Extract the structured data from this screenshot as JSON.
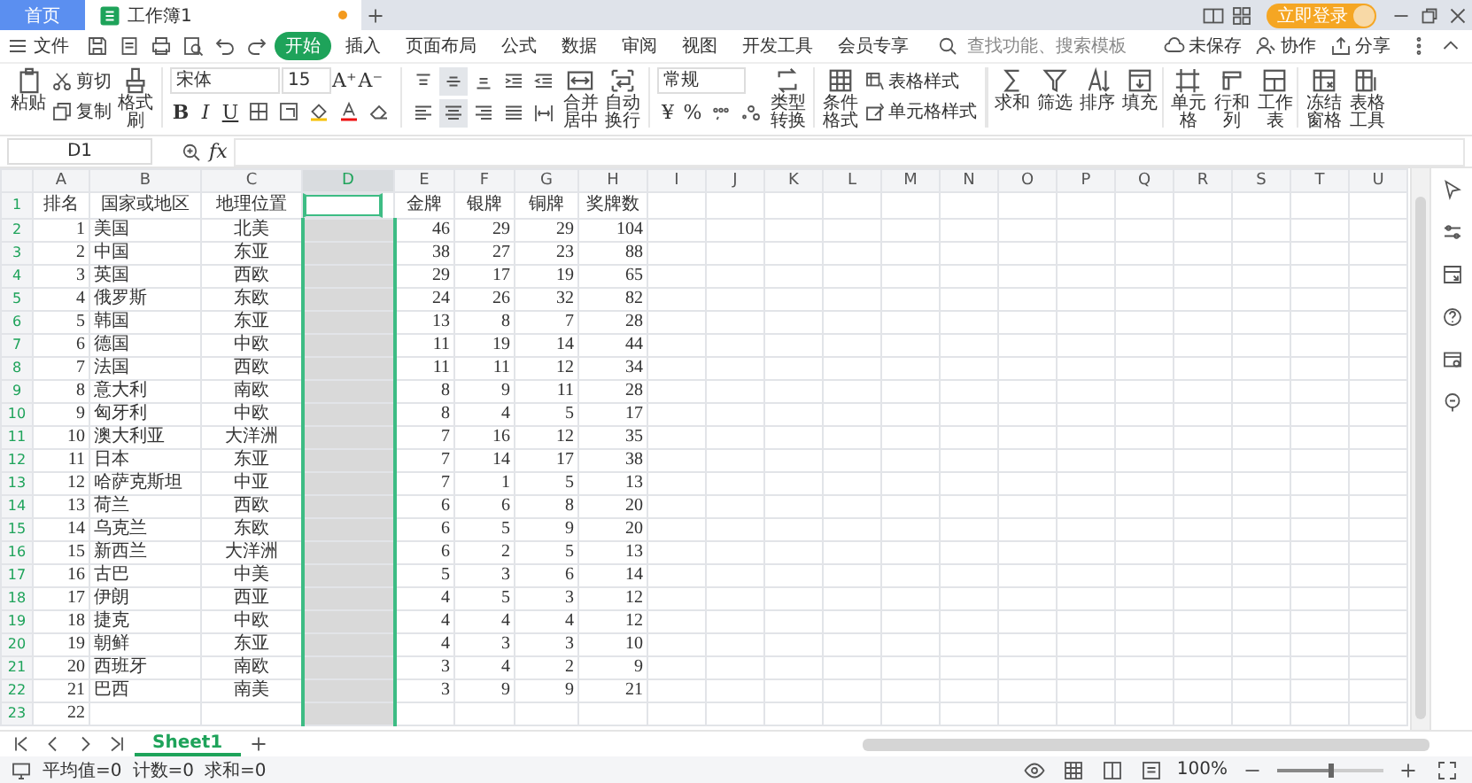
{
  "title_tabs": [
    {
      "label": "首页",
      "kind": "home",
      "selected": false,
      "unsaved": false
    },
    {
      "label": "工作簿1",
      "kind": "workbook",
      "selected": true,
      "unsaved": true
    }
  ],
  "login": "立即登录",
  "file_menu": "文件",
  "menu": [
    {
      "label": "开始",
      "selected": true
    },
    {
      "label": "插入",
      "selected": false
    },
    {
      "label": "页面布局",
      "selected": false
    },
    {
      "label": "公式",
      "selected": false
    },
    {
      "label": "数据",
      "selected": false
    },
    {
      "label": "审阅",
      "selected": false
    },
    {
      "label": "视图",
      "selected": false
    },
    {
      "label": "开发工具",
      "selected": false
    },
    {
      "label": "会员专享",
      "selected": false
    }
  ],
  "search": {
    "placeholder": "查找功能、搜索模板"
  },
  "actions": [
    {
      "label": "未保存",
      "kind": "cloud"
    },
    {
      "label": "协作",
      "kind": "people"
    },
    {
      "label": "分享",
      "kind": "share"
    }
  ],
  "ribbon": {
    "paste": "粘贴",
    "cut": "剪切",
    "copy": "复制",
    "painter": "格式刷",
    "font": "宋体",
    "font_size": "15",
    "grow_font": "A⁺",
    "shrink_font": "A⁻",
    "format_buttons": [
      "B",
      "I",
      "U"
    ],
    "merge": "合并居中",
    "wrap": "自动换行",
    "number_format": "常规",
    "currency": "¥",
    "percent": "%",
    "convert": "类型转换",
    "conditional": "条件格式",
    "table_style": "表格样式",
    "cell_style": "单元格样式",
    "commands": [
      {
        "label": "求和",
        "kind": "sum"
      },
      {
        "label": "筛选",
        "kind": "filter"
      },
      {
        "label": "排序",
        "kind": "sort"
      },
      {
        "label": "填充",
        "kind": "fill"
      },
      {
        "label": "单元格",
        "kind": "cell"
      },
      {
        "label": "行和列",
        "kind": "rowcol"
      },
      {
        "label": "工作表",
        "kind": "sheet"
      },
      {
        "label": "冻结窗格",
        "kind": "freeze"
      },
      {
        "label": "表格工具",
        "kind": "tools"
      }
    ]
  },
  "name_box": "D1",
  "formula_label": "fx",
  "columns": [
    {
      "label": "A",
      "selected": false
    },
    {
      "label": "B",
      "selected": false
    },
    {
      "label": "C",
      "selected": false
    },
    {
      "label": "D",
      "selected": true
    },
    {
      "label": "E",
      "selected": false
    },
    {
      "label": "F",
      "selected": false
    },
    {
      "label": "G",
      "selected": false
    },
    {
      "label": "H",
      "selected": false
    },
    {
      "label": "I",
      "selected": false
    },
    {
      "label": "J",
      "selected": false
    },
    {
      "label": "K",
      "selected": false
    },
    {
      "label": "L",
      "selected": false
    },
    {
      "label": "M",
      "selected": false
    },
    {
      "label": "N",
      "selected": false
    },
    {
      "label": "O",
      "selected": false
    },
    {
      "label": "P",
      "selected": false
    },
    {
      "label": "Q",
      "selected": false
    },
    {
      "label": "R",
      "selected": false
    },
    {
      "label": "S",
      "selected": false
    },
    {
      "label": "T",
      "selected": false
    },
    {
      "label": "U",
      "selected": false
    }
  ],
  "rows": [
    {
      "number": "1",
      "rank": "排名",
      "country": "国家或地区",
      "region": "地理位置",
      "gold": "金牌",
      "silver": "银牌",
      "bronze": "铜牌",
      "total": "奖牌数"
    },
    {
      "number": "2",
      "rank": "1",
      "country": "美国",
      "region": "北美",
      "gold": "46",
      "silver": "29",
      "bronze": "29",
      "total": "104"
    },
    {
      "number": "3",
      "rank": "2",
      "country": "中国",
      "region": "东亚",
      "gold": "38",
      "silver": "27",
      "bronze": "23",
      "total": "88"
    },
    {
      "number": "4",
      "rank": "3",
      "country": "英国",
      "region": "西欧",
      "gold": "29",
      "silver": "17",
      "bronze": "19",
      "total": "65"
    },
    {
      "number": "5",
      "rank": "4",
      "country": "俄罗斯",
      "region": "东欧",
      "gold": "24",
      "silver": "26",
      "bronze": "32",
      "total": "82"
    },
    {
      "number": "6",
      "rank": "5",
      "country": "韩国",
      "region": "东亚",
      "gold": "13",
      "silver": "8",
      "bronze": "7",
      "total": "28"
    },
    {
      "number": "7",
      "rank": "6",
      "country": "德国",
      "region": "中欧",
      "gold": "11",
      "silver": "19",
      "bronze": "14",
      "total": "44"
    },
    {
      "number": "8",
      "rank": "7",
      "country": "法国",
      "region": "西欧",
      "gold": "11",
      "silver": "11",
      "bronze": "12",
      "total": "34"
    },
    {
      "number": "9",
      "rank": "8",
      "country": "意大利",
      "region": "南欧",
      "gold": "8",
      "silver": "9",
      "bronze": "11",
      "total": "28"
    },
    {
      "number": "10",
      "rank": "9",
      "country": "匈牙利",
      "region": "中欧",
      "gold": "8",
      "silver": "4",
      "bronze": "5",
      "total": "17"
    },
    {
      "number": "11",
      "rank": "10",
      "country": "澳大利亚",
      "region": "大洋洲",
      "gold": "7",
      "silver": "16",
      "bronze": "12",
      "total": "35"
    },
    {
      "number": "12",
      "rank": "11",
      "country": "日本",
      "region": "东亚",
      "gold": "7",
      "silver": "14",
      "bronze": "17",
      "total": "38"
    },
    {
      "number": "13",
      "rank": "12",
      "country": "哈萨克斯坦",
      "region": "中亚",
      "gold": "7",
      "silver": "1",
      "bronze": "5",
      "total": "13"
    },
    {
      "number": "14",
      "rank": "13",
      "country": "荷兰",
      "region": "西欧",
      "gold": "6",
      "silver": "6",
      "bronze": "8",
      "total": "20"
    },
    {
      "number": "15",
      "rank": "14",
      "country": "乌克兰",
      "region": "东欧",
      "gold": "6",
      "silver": "5",
      "bronze": "9",
      "total": "20"
    },
    {
      "number": "16",
      "rank": "15",
      "country": "新西兰",
      "region": "大洋洲",
      "gold": "6",
      "silver": "2",
      "bronze": "5",
      "total": "13"
    },
    {
      "number": "17",
      "rank": "16",
      "country": "古巴",
      "region": "中美",
      "gold": "5",
      "silver": "3",
      "bronze": "6",
      "total": "14"
    },
    {
      "number": "18",
      "rank": "17",
      "country": "伊朗",
      "region": "西亚",
      "gold": "4",
      "silver": "5",
      "bronze": "3",
      "total": "12"
    },
    {
      "number": "19",
      "rank": "18",
      "country": "捷克",
      "region": "中欧",
      "gold": "4",
      "silver": "4",
      "bronze": "4",
      "total": "12"
    },
    {
      "number": "20",
      "rank": "19",
      "country": "朝鲜",
      "region": "东亚",
      "gold": "4",
      "silver": "3",
      "bronze": "3",
      "total": "10"
    },
    {
      "number": "21",
      "rank": "20",
      "country": "西班牙",
      "region": "南欧",
      "gold": "3",
      "silver": "4",
      "bronze": "2",
      "total": "9"
    },
    {
      "number": "22",
      "rank": "21",
      "country": "巴西",
      "region": "南美",
      "gold": "3",
      "silver": "9",
      "bronze": "9",
      "total": "21"
    },
    {
      "number": "23",
      "rank": "22"
    }
  ],
  "zoom_slider": {
    "level": 0.5
  },
  "sheets": [
    {
      "label": "Sheet1",
      "selected": true
    }
  ],
  "status": [
    "平均值=0",
    "计数=0",
    "求和=0"
  ],
  "zoom": "100%"
}
